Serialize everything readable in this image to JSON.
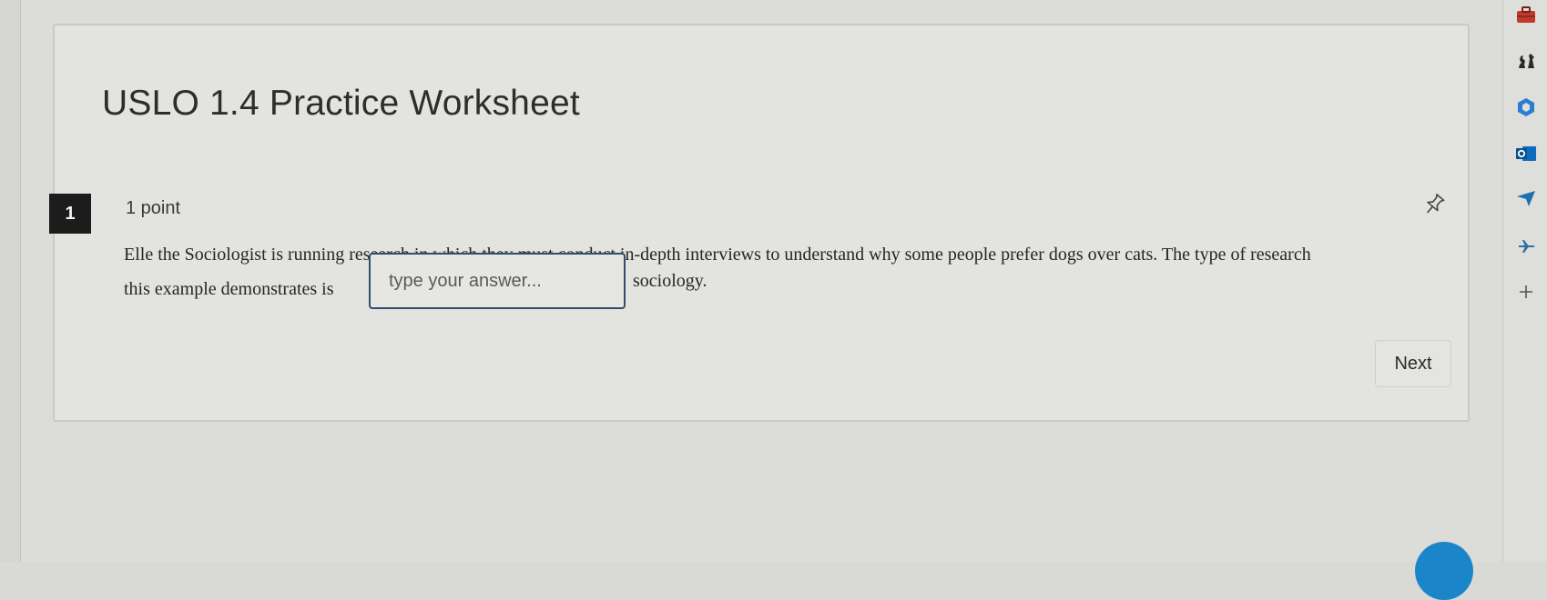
{
  "worksheet": {
    "title": "USLO 1.4 Practice Worksheet"
  },
  "question": {
    "number": "1",
    "points": "1 point",
    "text_line1": "Elle the Sociologist is running research in which they must conduct in-depth interviews to understand why some people prefer dogs over cats. The type of research",
    "text_line2": "this example demonstrates is",
    "answer_placeholder": "type your answer...",
    "answer_value": "",
    "text_after": "sociology."
  },
  "navigation": {
    "next_label": "Next"
  },
  "icons": {
    "pin": "pin-icon",
    "rail": [
      "briefcase-icon",
      "chess-icon",
      "office-icon",
      "outlook-icon",
      "send-icon",
      "airplane-icon",
      "plus-icon"
    ]
  },
  "colors": {
    "accent": "#2e4e6e",
    "fab": "#1a86c9",
    "outlook_blue": "#0f6cbd",
    "office_blue": "#2b7cd3",
    "briefcase_red": "#c0392b"
  }
}
